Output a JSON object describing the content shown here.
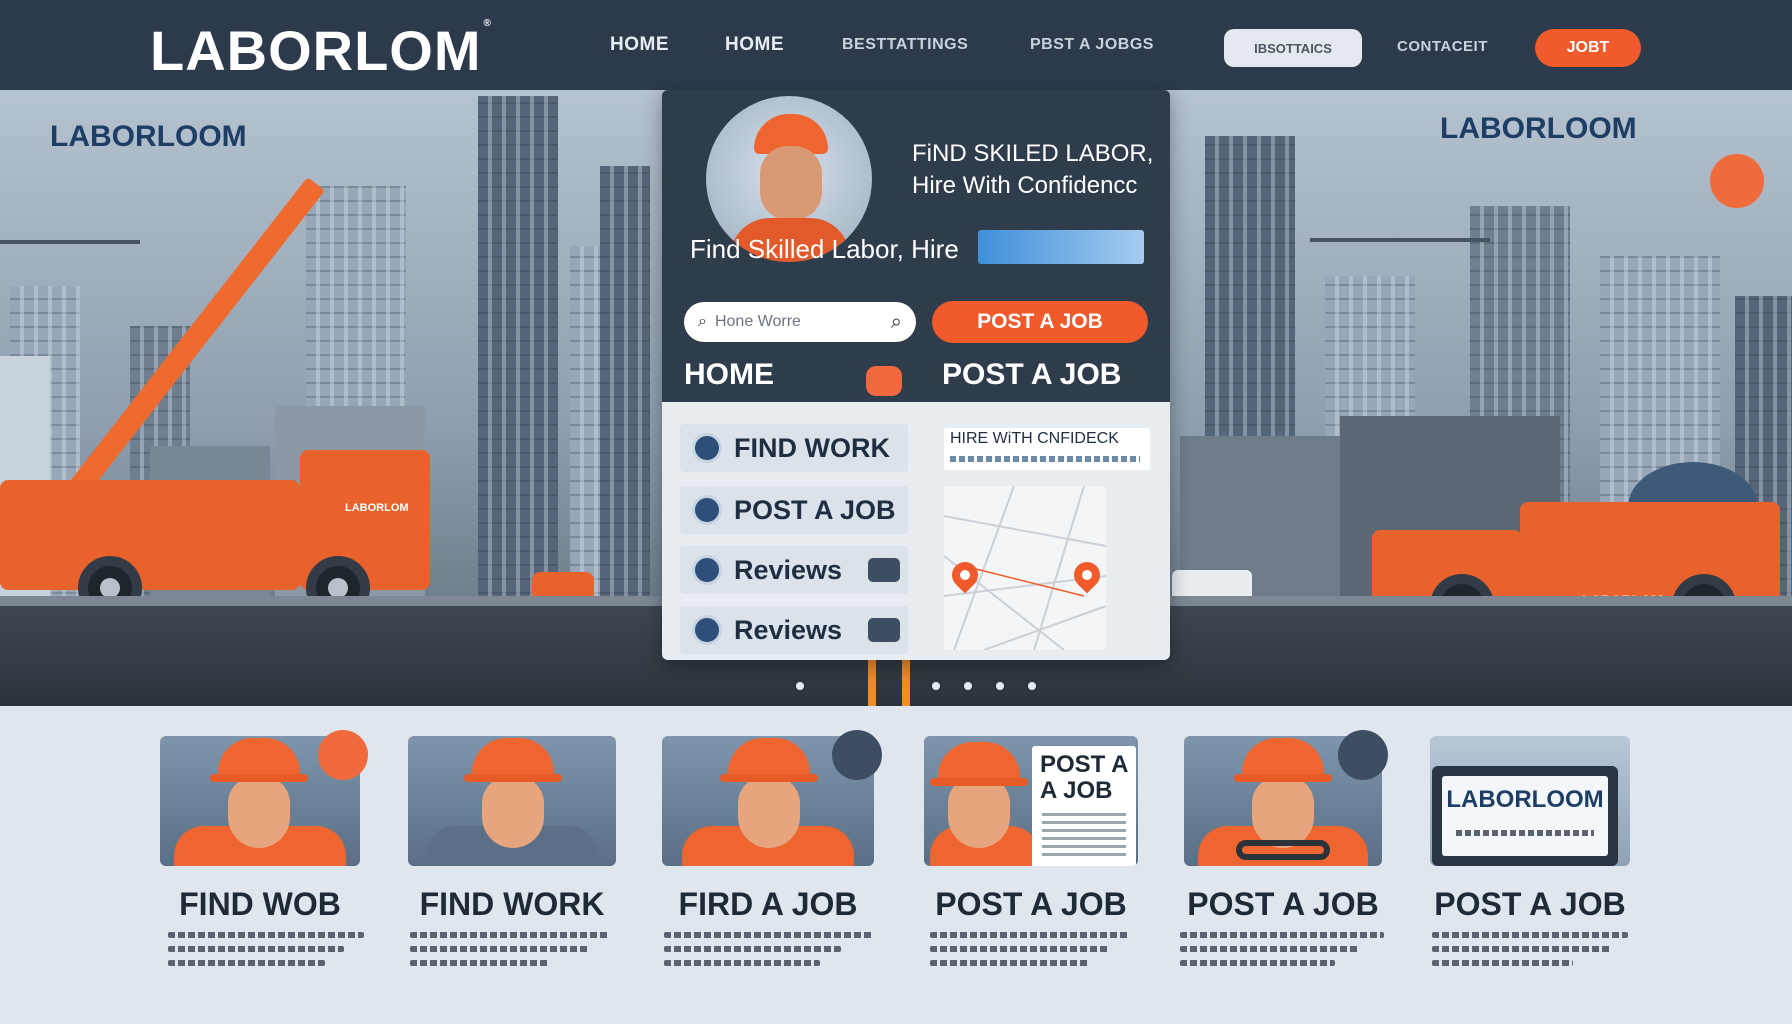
{
  "header": {
    "logo": "LABORLOM",
    "logo_mark": "®",
    "nav": [
      "HOME",
      "HOME",
      "BESTTATTINGS",
      "PBST A JOBGS"
    ],
    "pill": "IBSOTTAICS",
    "contact": "CONTACEIT",
    "cta": "JOBT"
  },
  "hero": {
    "left_brand": "LABORLOOM",
    "right_brand": "LABORLOOM",
    "truck_right_label": "LABORLOM",
    "truck_left_label": "LABORLOM"
  },
  "card": {
    "headline_right": "FiND SKILED LABOR, Hire With Confidencc",
    "headline_left": "Find Skilled Labor, Hire",
    "search_placeholder": "Hone Worre",
    "post_button": "POST A JOB",
    "home_label": "HOME",
    "post_label": "POST A JOB",
    "menu": [
      {
        "label": "FIND WORK",
        "icon": "globe-icon"
      },
      {
        "label": "POST A JOB",
        "icon": "briefcase-icon"
      },
      {
        "label": "Reviews",
        "icon": "info-icon"
      },
      {
        "label": "Reviews",
        "icon": "info-icon"
      }
    ],
    "hire_text": "HIRE WiTH CNFIDECK",
    "map_icon": "map-pin-icon"
  },
  "tiles": [
    {
      "title": "FIND  WOB"
    },
    {
      "title": "FIND WORK"
    },
    {
      "title": "FIRD A JOB"
    },
    {
      "title": "POST A JOB",
      "paper": "POST A A JOB"
    },
    {
      "title": "POST A JOB"
    },
    {
      "title": "POST A JOB",
      "sign": "LABORLOOM"
    }
  ],
  "colors": {
    "navy": "#2c3a4b",
    "accent": "#f15a2b",
    "brand_blue": "#1f3e66"
  }
}
